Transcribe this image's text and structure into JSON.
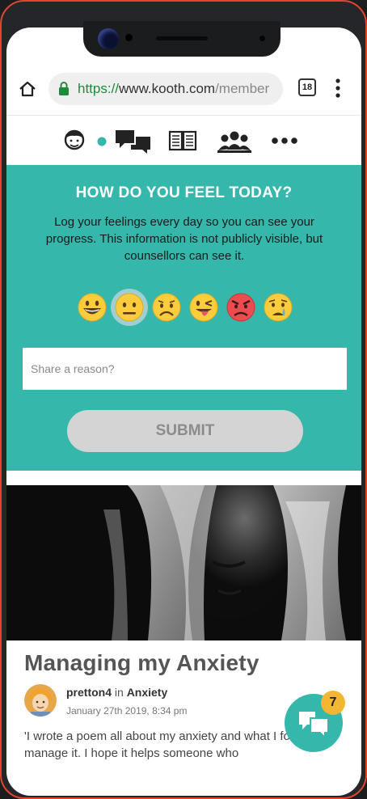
{
  "browser": {
    "url_scheme": "https://",
    "url_host": "www.kooth.com",
    "url_path": "/member",
    "tab_count": "18"
  },
  "nav": {
    "items": [
      "profile-icon",
      "messages-icon",
      "magazine-icon",
      "community-icon",
      "more-icon"
    ]
  },
  "mood": {
    "title": "HOW DO YOU FEEL TODAY?",
    "description": "Log your feelings every day so you can see your progress. This information is not publicly visible, but counsellors can see it.",
    "reason_placeholder": "Share a reason?",
    "submit_label": "SUBMIT",
    "selected_index": 1
  },
  "article": {
    "title": "Managing my Anxiety",
    "author": "pretton4",
    "in_label": "in",
    "category": "Anxiety",
    "date": "January 27th 2019, 8:34 pm",
    "excerpt": "'I wrote a poem all about my anxiety and what I found to manage it. I hope it helps someone who"
  },
  "chat": {
    "badge_count": "7"
  },
  "colors": {
    "teal": "#35b8ab",
    "badge": "#f3b632"
  }
}
